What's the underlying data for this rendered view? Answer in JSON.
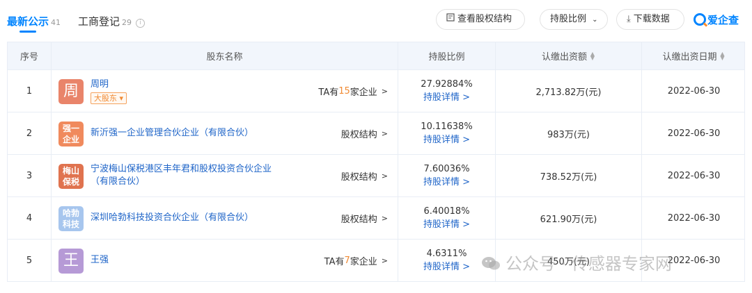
{
  "tabs": [
    {
      "label": "最新公示",
      "count": "41"
    },
    {
      "label": "工商登记",
      "count": "29"
    }
  ],
  "toolbar": {
    "structure_label": "查看股权结构",
    "ratio_label": "持股比例",
    "download_label": "下载数据",
    "brand": "爱企查"
  },
  "headers": {
    "index": "序号",
    "name": "股东名称",
    "ratio": "持股比例",
    "amount": "认缴出资额",
    "date": "认缴出资日期"
  },
  "rows": [
    {
      "index": "1",
      "avatar": "周",
      "avatar_color": "#e9846a",
      "name": "周明",
      "badge": "大股东",
      "link_pre": "TA有",
      "link_hl": "15",
      "link_post": "家企业",
      "ratio": "27.92884%",
      "detail": "持股详情",
      "amount": "2,713.82万(元)",
      "date": "2022-06-30"
    },
    {
      "index": "2",
      "avatar": "强一企业",
      "avatar_color": "#f08a5d",
      "name": "新沂强一企业管理合伙企业（有限合伙）",
      "badge": "",
      "link_pre": "股权结构",
      "link_hl": "",
      "link_post": "",
      "ratio": "10.11638%",
      "detail": "持股详情",
      "amount": "983万(元)",
      "date": "2022-06-30"
    },
    {
      "index": "3",
      "avatar": "梅山保税",
      "avatar_color": "#e0734f",
      "name": "宁波梅山保税港区丰年君和股权投资合伙企业（有限合伙）",
      "badge": "",
      "link_pre": "股权结构",
      "link_hl": "",
      "link_post": "",
      "ratio": "7.60036%",
      "detail": "持股详情",
      "amount": "738.52万(元)",
      "date": "2022-06-30"
    },
    {
      "index": "4",
      "avatar": "哈勃科技",
      "avatar_color": "#a7c6ee",
      "name": "深圳哈勃科技投资合伙企业（有限合伙）",
      "badge": "",
      "link_pre": "股权结构",
      "link_hl": "",
      "link_post": "",
      "ratio": "6.40018%",
      "detail": "持股详情",
      "amount": "621.90万(元)",
      "date": "2022-06-30"
    },
    {
      "index": "5",
      "avatar": "王",
      "avatar_color": "#b69ad6",
      "name": "王强",
      "badge": "",
      "link_pre": "TA有",
      "link_hl": "7",
      "link_post": "家企业",
      "ratio": "4.6311%",
      "detail": "持股详情",
      "amount": "450万(元)",
      "date": "2022-06-30"
    }
  ],
  "watermark": "公众号 · 传感器专家网"
}
